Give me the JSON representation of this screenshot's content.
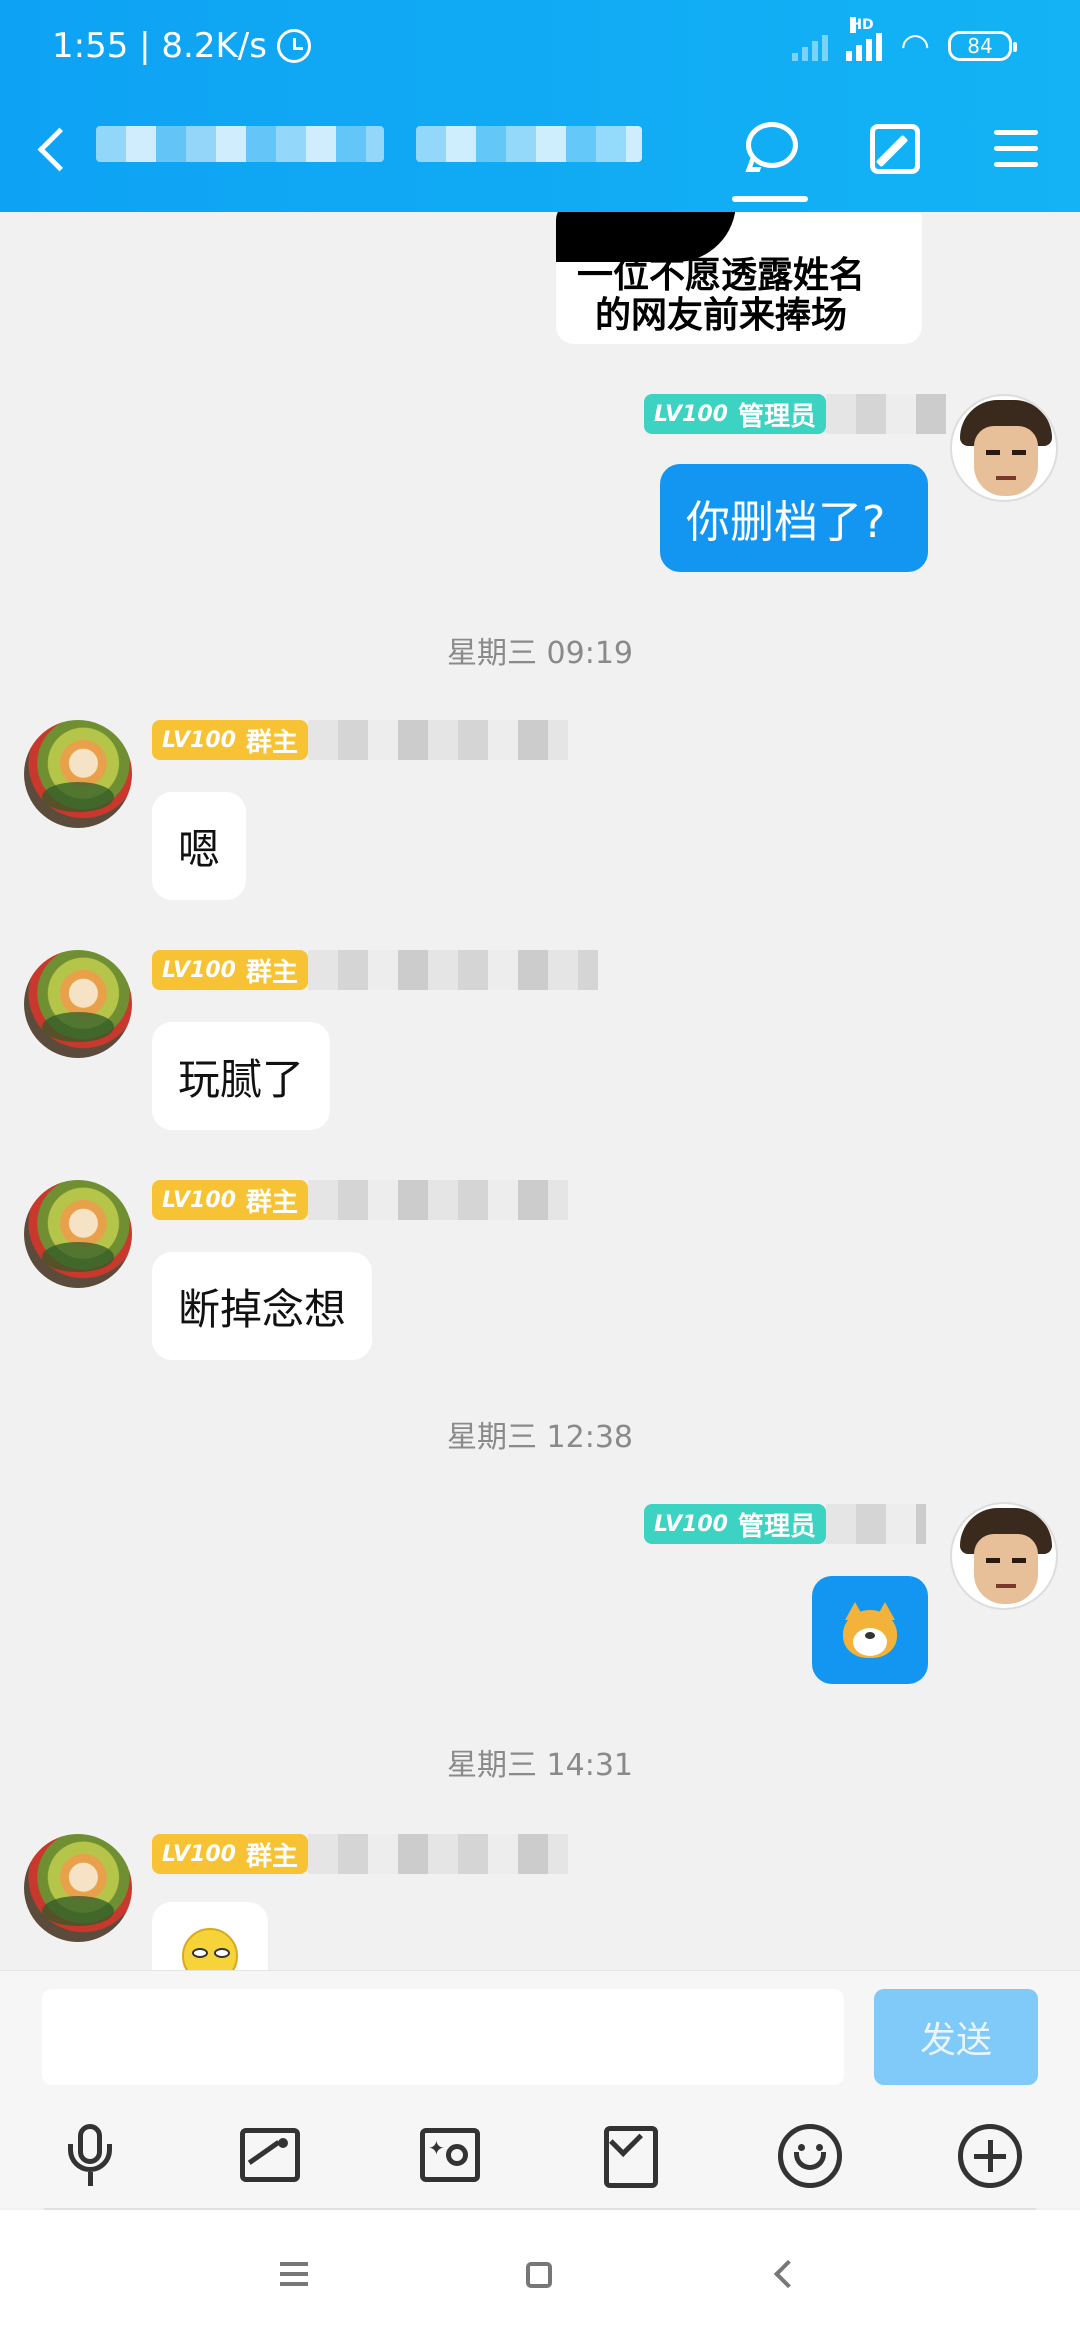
{
  "status_bar": {
    "time_speed": "1:55 | 8.2K/s",
    "hd_label": "HD",
    "battery": "84"
  },
  "header": {
    "tabs": [
      {
        "icon": "chat-bubble-icon",
        "active": true
      },
      {
        "icon": "edit-icon"
      },
      {
        "icon": "menu-icon"
      }
    ]
  },
  "messages": {
    "image_caption_line1": "一位不愿透露姓名",
    "image_caption_line2": "的网友前来捧场",
    "admin_badge": {
      "level": "LV100",
      "role": "管理员"
    },
    "owner_badge": {
      "level": "LV100",
      "role": "群主"
    },
    "msg_you_deleted_save": "你删档了?",
    "time_1": "星期三 09:19",
    "msg_1": "嗯",
    "msg_2": "玩腻了",
    "msg_3": "断掉念想",
    "time_2": "星期三 12:38",
    "time_3": "星期三 14:31"
  },
  "input": {
    "send_label": "发送",
    "placeholder": ""
  },
  "toolbar": {
    "icons": [
      "microphone-icon",
      "image-icon",
      "camera-icon",
      "red-packet-icon",
      "emoji-icon",
      "plus-icon"
    ]
  },
  "colors": {
    "header_blue": "#0ea2f4",
    "outgoing_bubble": "#1296f2",
    "owner_badge": "#f7c234",
    "admin_badge": "#3cd3c3",
    "send_button": "#7fcaf8"
  }
}
